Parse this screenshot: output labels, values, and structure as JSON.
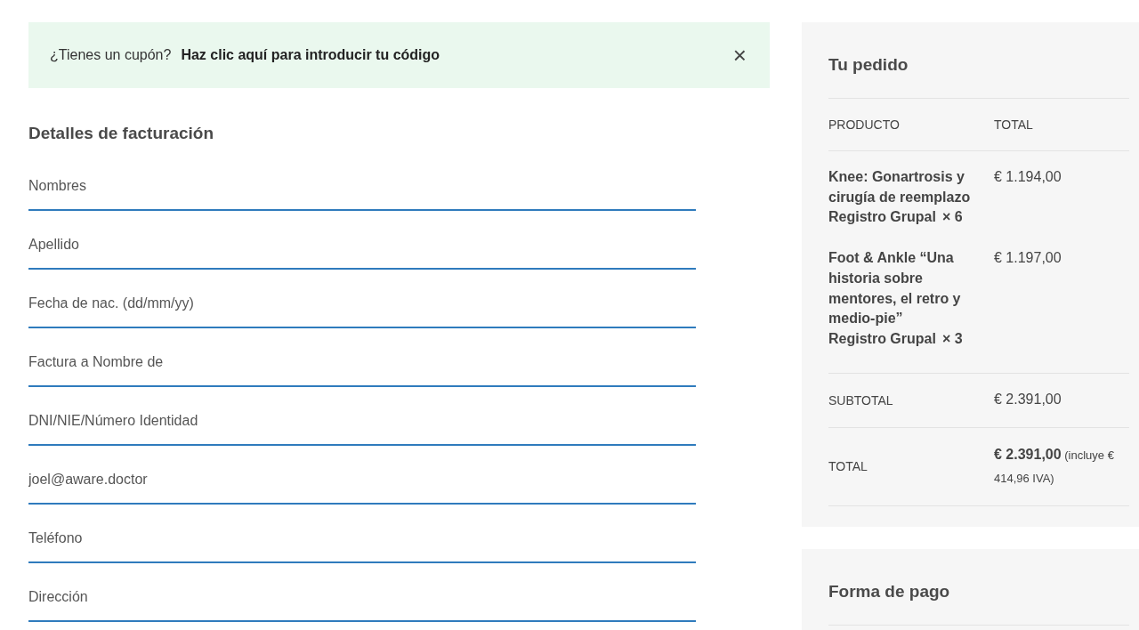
{
  "coupon": {
    "question": "¿Tienes un cupón?",
    "link": "Haz clic aquí para introducir tu código",
    "close": "×"
  },
  "billing": {
    "title": "Detalles de facturación",
    "fields": [
      {
        "placeholder": "Nombres"
      },
      {
        "placeholder": "Apellido"
      },
      {
        "placeholder": "Fecha de nac. (dd/mm/yy)"
      },
      {
        "placeholder": "Factura a Nombre de"
      },
      {
        "placeholder": "DNI/NIE/Número Identidad"
      },
      {
        "value": "joel@aware.doctor"
      },
      {
        "placeholder": "Teléfono"
      },
      {
        "placeholder": "Dirección"
      }
    ]
  },
  "order": {
    "title": "Tu pedido",
    "columns": [
      "PRODUCTO",
      "TOTAL"
    ],
    "items": [
      {
        "name": "Knee: Gonartrosis y cirugía de reemplazo",
        "variation": "Registro Grupal",
        "quantity": "× 6",
        "total": "€ 1.194,00"
      },
      {
        "name": "Foot & Ankle “Una historia sobre mentores, el retro y medio-pie”",
        "variation": "Registro Grupal",
        "quantity": "× 3",
        "total": "€ 1.197,00"
      }
    ],
    "subtotal": {
      "label": "SUBTOTAL",
      "value": "€ 2.391,00"
    },
    "total": {
      "label": "TOTAL",
      "value": "**€ 2.391,00** (incluye € 414,96 IVA)"
    }
  },
  "payment": {
    "title": "Forma de pago"
  }
}
